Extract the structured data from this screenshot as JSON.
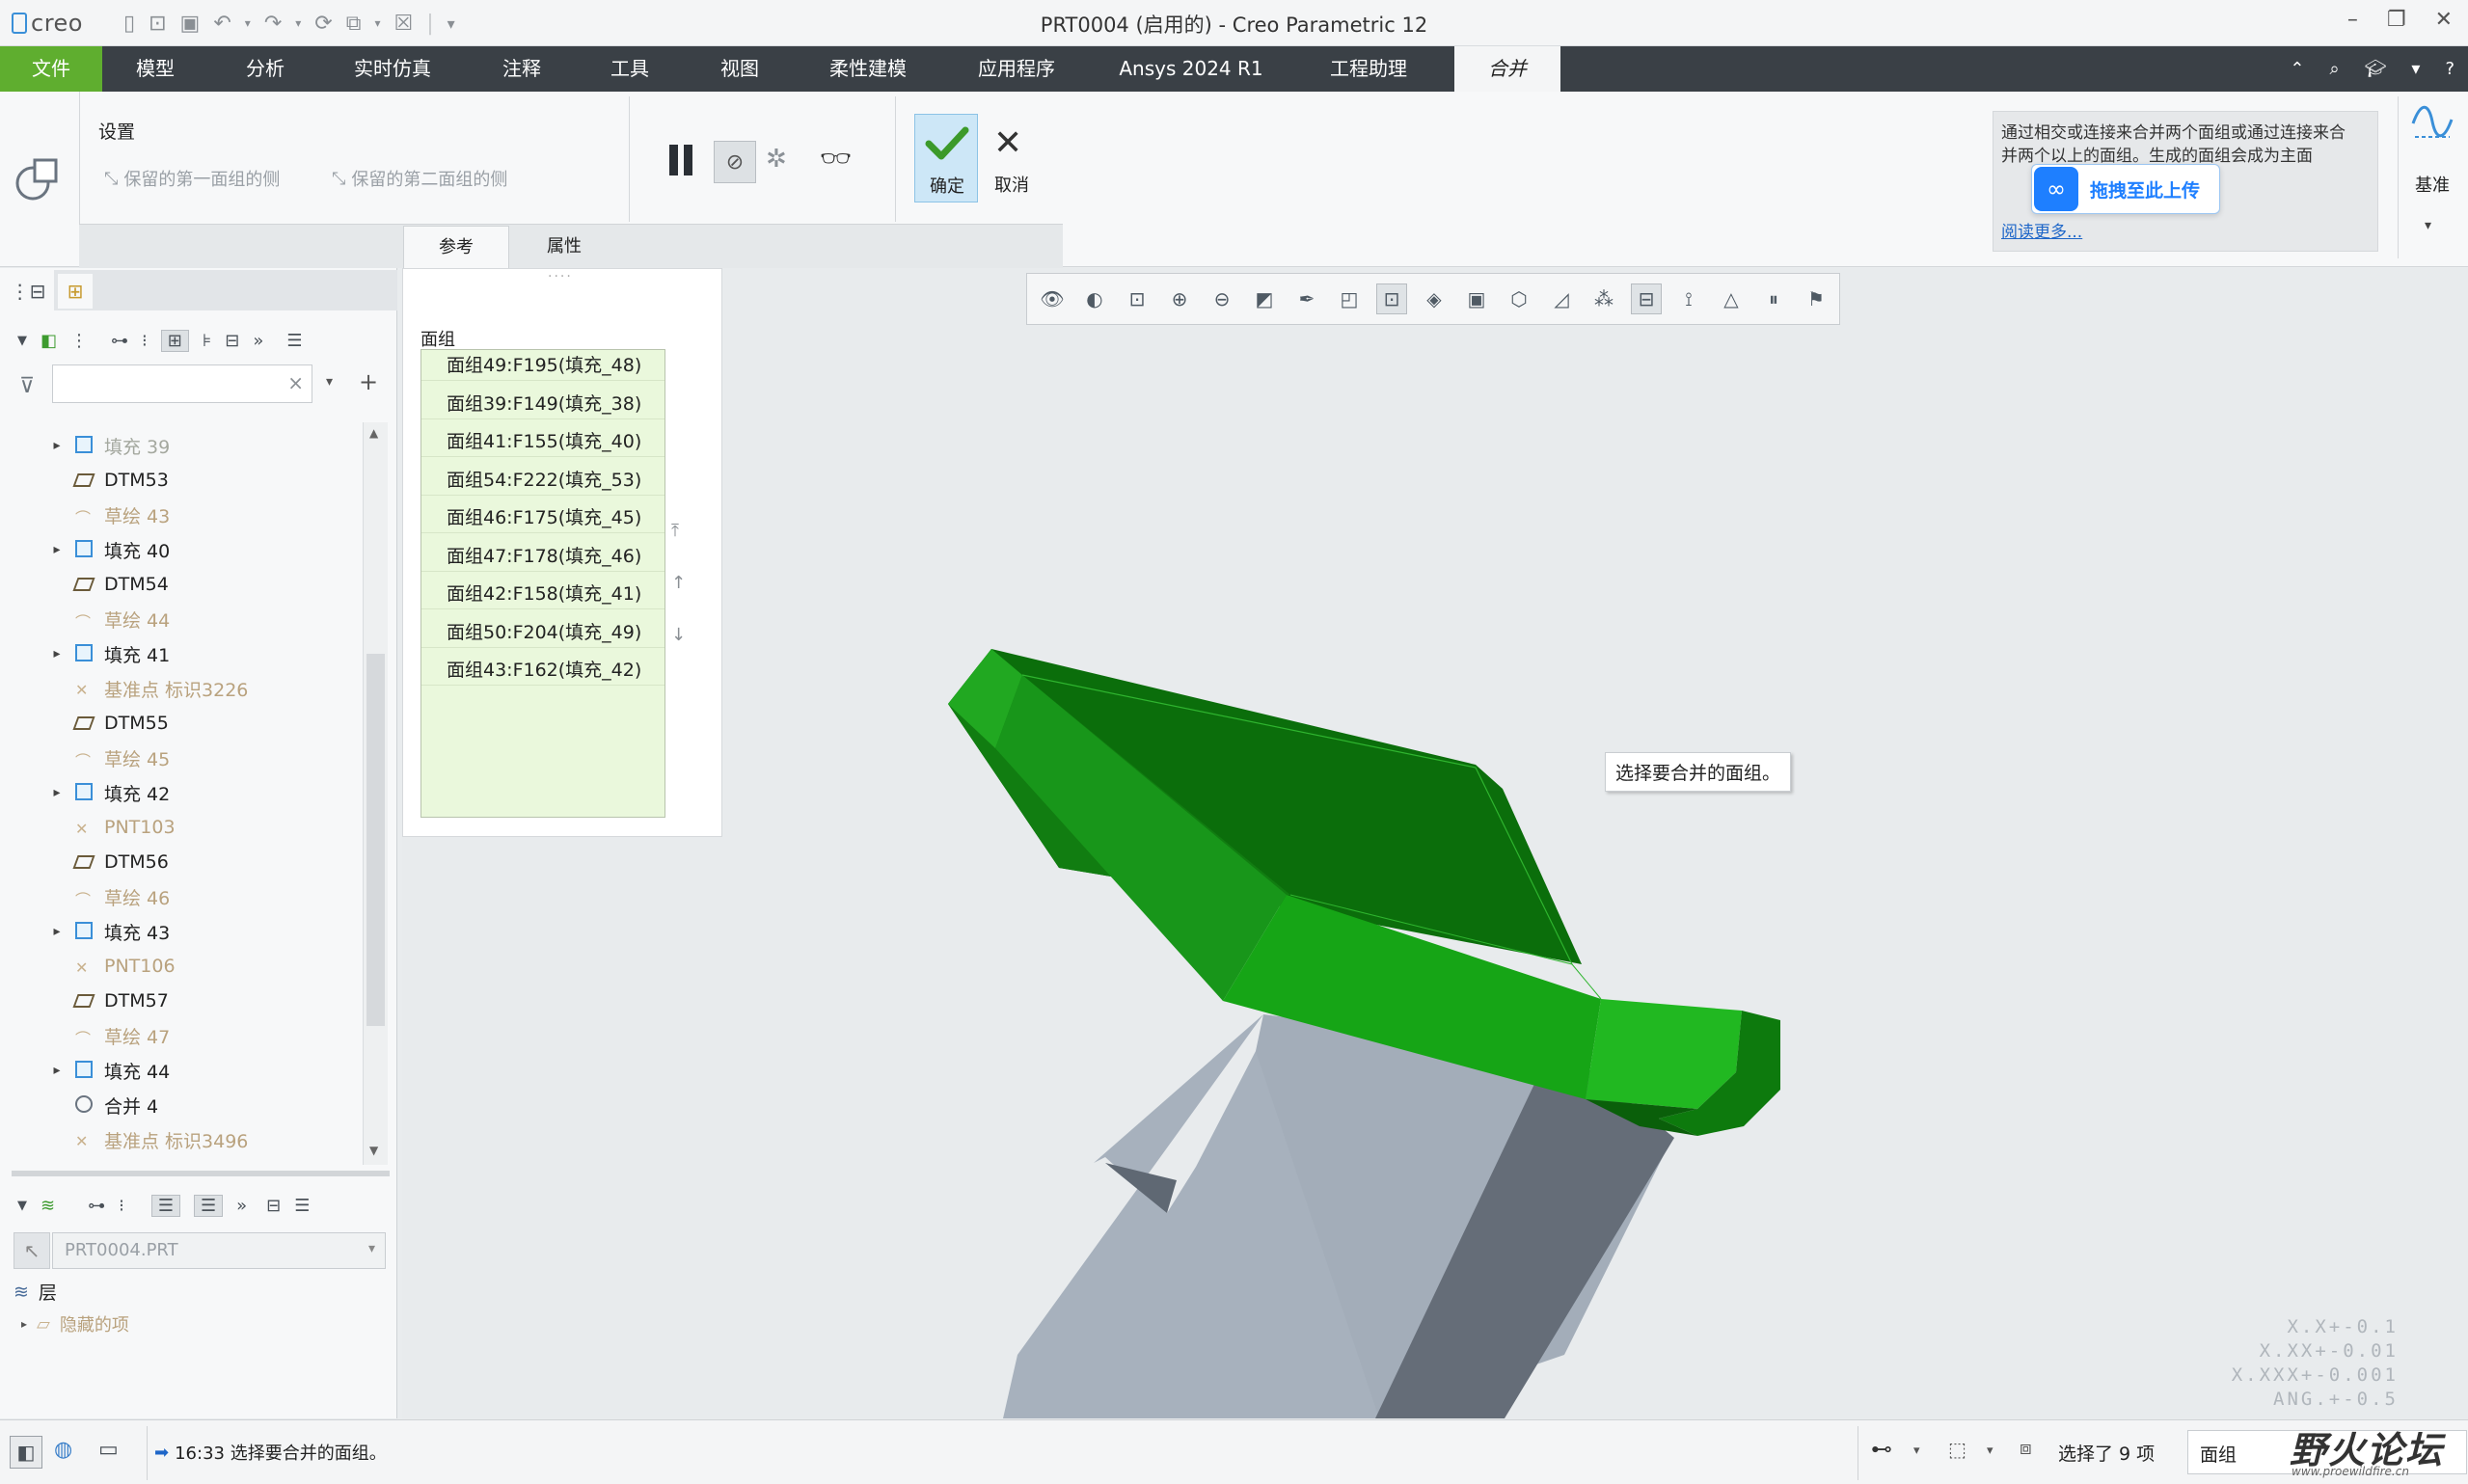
{
  "app": {
    "window_title": "PRT0004 (启用的) - Creo Parametric 12",
    "logo_text": "creo"
  },
  "menu": {
    "tabs": [
      "文件",
      "模型",
      "分析",
      "实时仿真",
      "注释",
      "工具",
      "视图",
      "柔性建模",
      "应用程序",
      "Ansys 2024 R1",
      "工程助理",
      "合并"
    ],
    "active_tab": "合并",
    "icons": [
      "caret-up-icon",
      "search-icon",
      "graduation-cap-icon",
      "chevron-down-icon",
      "help-icon"
    ]
  },
  "ribbon": {
    "settings_label": "设置",
    "keep_first_side": "保留的第一面组的侧",
    "keep_second_side": "保留的第二面组的侧",
    "ok_label": "确定",
    "cancel_label": "取消",
    "subtabs": [
      "参考",
      "属性"
    ],
    "help_text": "通过相交或连接来合并两个面组或通过连接来合并两个以上的面组。生成的面组会成为主面",
    "upload_label": "拖拽至此上传",
    "read_more": "阅读更多...",
    "datum_label": "基准"
  },
  "panel": {
    "collector_title": "面组",
    "items": [
      "面组49:F195(填充_48)",
      "面组39:F149(填充_38)",
      "面组41:F155(填充_40)",
      "面组54:F222(填充_53)",
      "面组46:F175(填充_45)",
      "面组47:F178(填充_46)",
      "面组42:F158(填充_41)",
      "面组50:F204(填充_49)",
      "面组43:F162(填充_42)"
    ]
  },
  "tree": {
    "search_placeholder": "",
    "items": [
      {
        "label": "填充 39",
        "type": "fill",
        "state": "dim",
        "expand": true
      },
      {
        "label": "DTM53",
        "type": "plane",
        "state": "normal",
        "expand": false
      },
      {
        "label": "草绘 43",
        "type": "sketch",
        "state": "dim",
        "expand": false
      },
      {
        "label": "填充 40",
        "type": "fill",
        "state": "normal",
        "expand": true
      },
      {
        "label": "DTM54",
        "type": "plane",
        "state": "normal",
        "expand": false
      },
      {
        "label": "草绘 44",
        "type": "sketch",
        "state": "dim",
        "expand": false
      },
      {
        "label": "填充 41",
        "type": "fill",
        "state": "normal",
        "expand": true
      },
      {
        "label": "基准点 标识3226",
        "type": "point",
        "state": "dim",
        "expand": false
      },
      {
        "label": "DTM55",
        "type": "plane",
        "state": "normal",
        "expand": false
      },
      {
        "label": "草绘 45",
        "type": "sketch",
        "state": "dim",
        "expand": false
      },
      {
        "label": "填充 42",
        "type": "fill",
        "state": "normal",
        "expand": true
      },
      {
        "label": "PNT103",
        "type": "point",
        "state": "dim",
        "expand": false
      },
      {
        "label": "DTM56",
        "type": "plane",
        "state": "normal",
        "expand": false
      },
      {
        "label": "草绘 46",
        "type": "sketch",
        "state": "dim",
        "expand": false
      },
      {
        "label": "填充 43",
        "type": "fill",
        "state": "normal",
        "expand": true
      },
      {
        "label": "PNT106",
        "type": "point",
        "state": "dim",
        "expand": false
      },
      {
        "label": "DTM57",
        "type": "plane",
        "state": "normal",
        "expand": false
      },
      {
        "label": "草绘 47",
        "type": "sketch",
        "state": "dim",
        "expand": false
      },
      {
        "label": "填充 44",
        "type": "fill",
        "state": "normal",
        "expand": true
      },
      {
        "label": "合并 4",
        "type": "merge",
        "state": "normal",
        "expand": false
      },
      {
        "label": "基准点 标识3496",
        "type": "point",
        "state": "dim",
        "expand": false
      }
    ]
  },
  "layers": {
    "model_select": "PRT0004.PRT",
    "layer_label": "层",
    "hidden_items": "隐藏的项"
  },
  "viewport": {
    "tooltip": "选择要合并的面组。",
    "tolerances": [
      "X.X+-0.1",
      "X.XX+-0.01",
      "X.XXX+-0.001",
      "ANG.+-0.5"
    ]
  },
  "status": {
    "message": "16:33 选择要合并的面组。",
    "selected_count": "选择了 9 项",
    "filter_value": "面组",
    "watermark_brand": "野火论坛",
    "watermark_url": "www.proewildfire.cn"
  },
  "colors": {
    "accent_green": "#5fae2f",
    "surface_green": "#1aa51a",
    "part_gray": "#a7b1bd",
    "menubar_dark": "#3a4046"
  }
}
